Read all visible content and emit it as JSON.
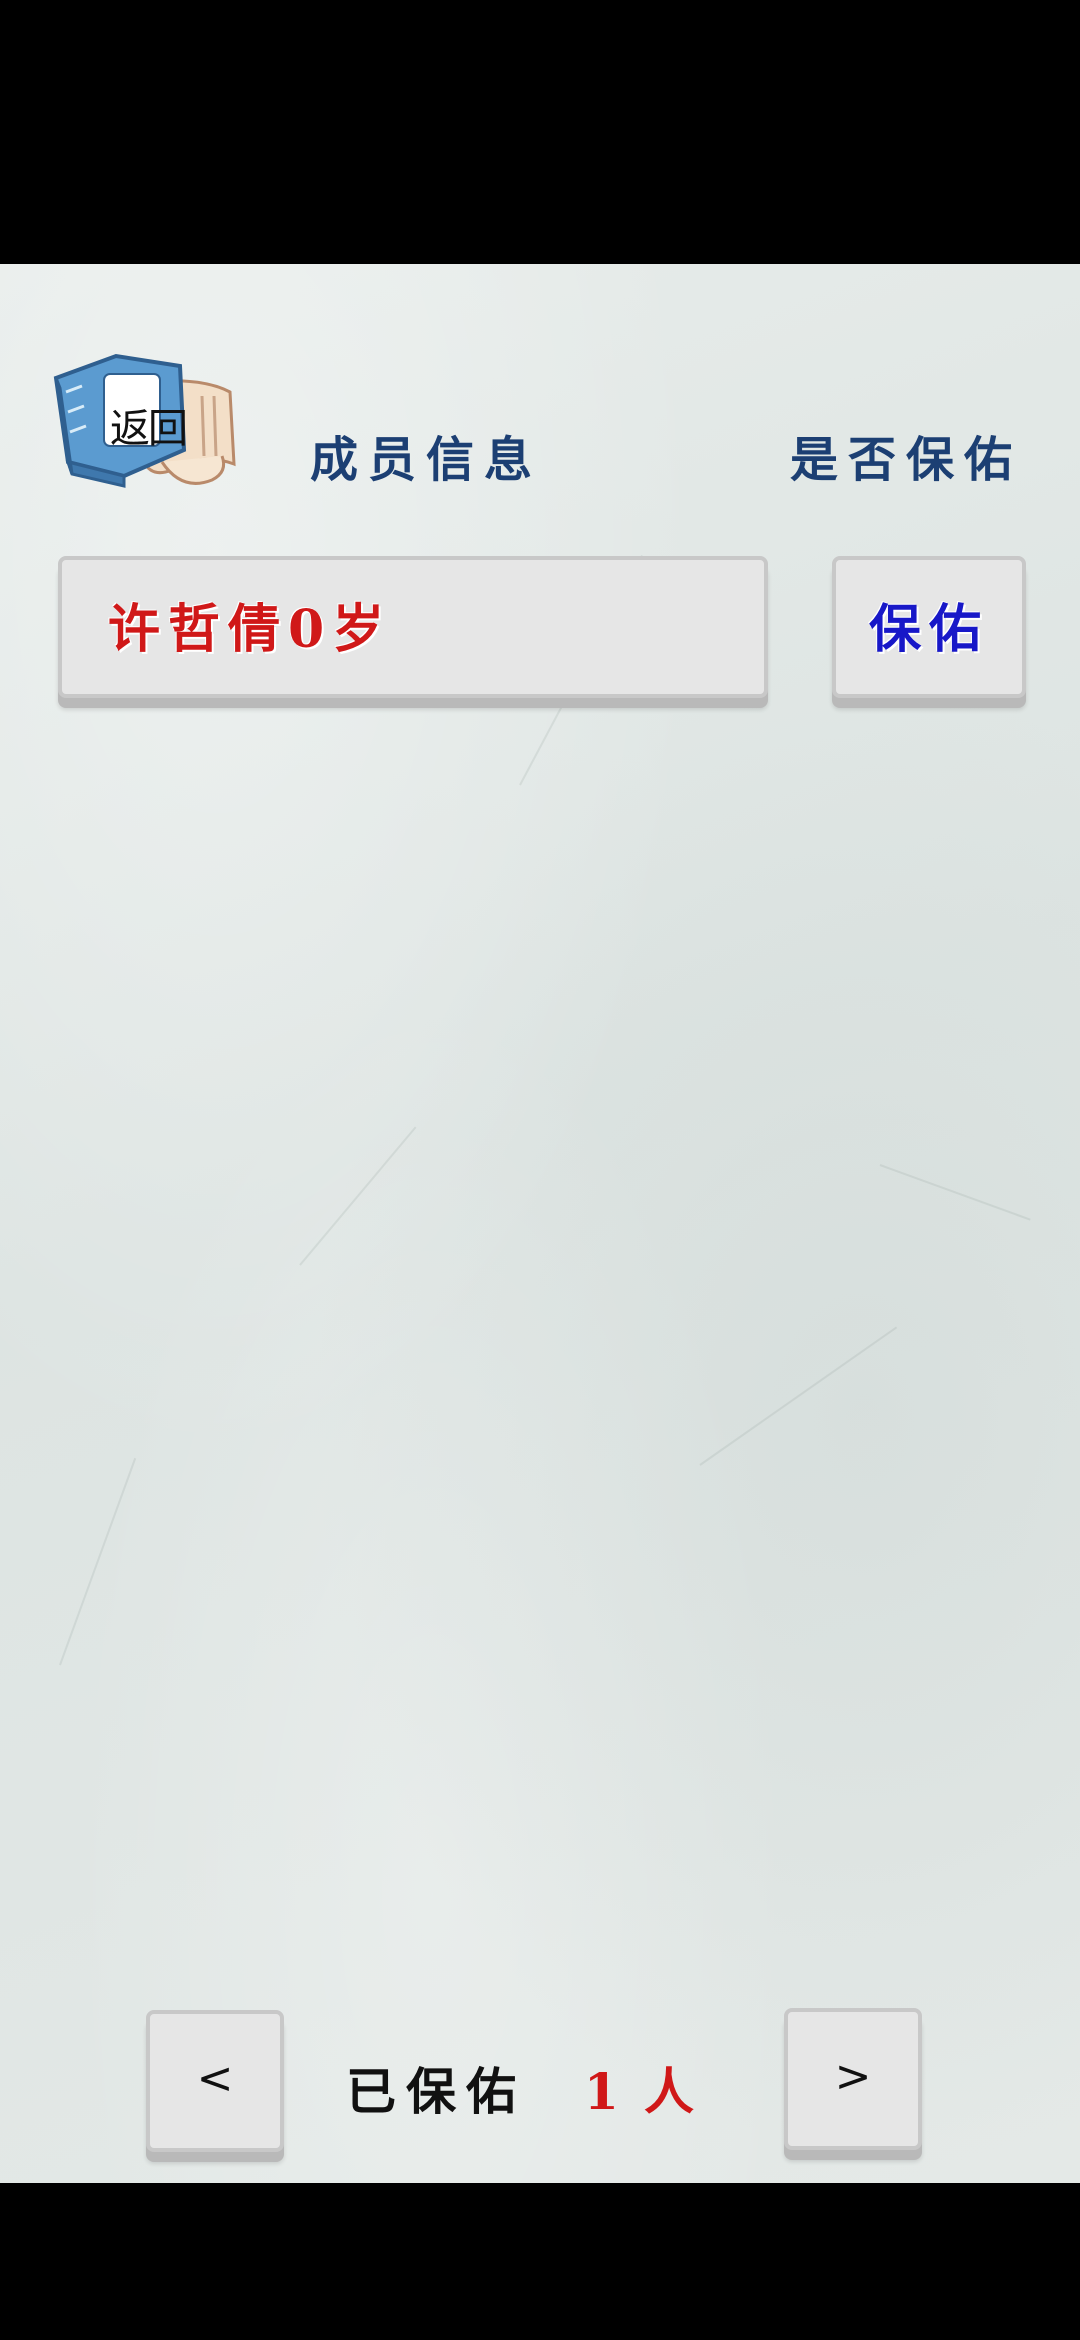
{
  "header": {
    "back_label": "返回",
    "member_info_label": "成员信息",
    "protect_status_label": "是否保佑"
  },
  "members": [
    {
      "text": "许哲倩0岁",
      "action_label": "保佑"
    }
  ],
  "footer": {
    "prev_label": "<",
    "next_label": ">",
    "protected_label": "已保佑",
    "protected_count": "1",
    "protected_unit": "人"
  },
  "colors": {
    "header_text": "#1c3f73",
    "member_text": "#d01818",
    "action_text": "#1818c8",
    "count_text": "#d01818",
    "background": "#e3e8e6"
  },
  "icons": {
    "back": "book-scroll-icon"
  }
}
